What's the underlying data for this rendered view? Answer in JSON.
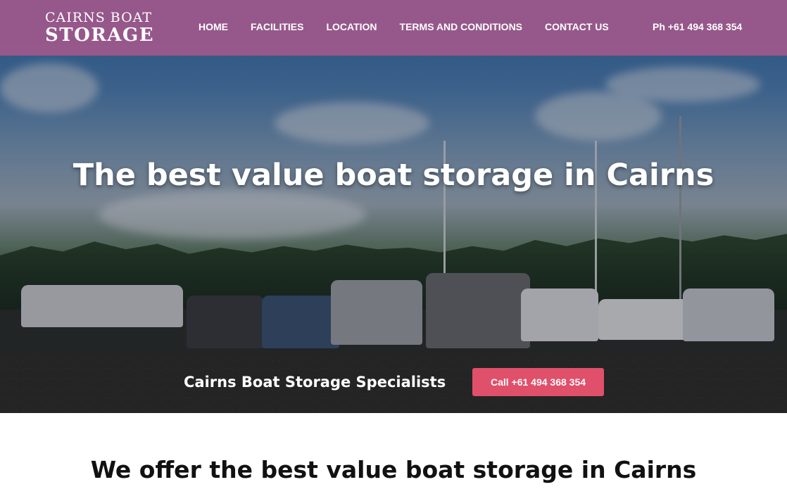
{
  "logo": {
    "line1": "CAIRNS BOAT",
    "line2": "STORAGE"
  },
  "nav": {
    "items": [
      {
        "label": "HOME"
      },
      {
        "label": "FACILITIES"
      },
      {
        "label": "LOCATION"
      },
      {
        "label": "TERMS AND CONDITIONS"
      },
      {
        "label": "CONTACT US"
      }
    ],
    "phone": "Ph +61 494 368 354"
  },
  "hero": {
    "title": "The best value boat storage in Cairns"
  },
  "band": {
    "text": "Cairns Boat Storage Specialists",
    "button_label": "Call +61 494 368 354"
  },
  "intro": {
    "before": "We offer the ",
    "bold": "best value boat storage",
    "after": " in Cairns"
  },
  "colors": {
    "header_bg": "#a0588c",
    "cta_button": "#e0506a",
    "band_bg": "#242424"
  }
}
